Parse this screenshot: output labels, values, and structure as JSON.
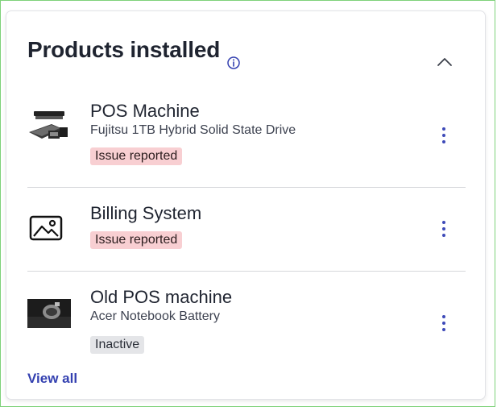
{
  "card": {
    "title": "Products installed",
    "view_all": "View all"
  },
  "products": [
    {
      "name": "POS Machine",
      "subtitle": "Fujitsu 1TB Hybrid Solid State Drive",
      "status": "Issue reported"
    },
    {
      "name": "Billing System",
      "subtitle": "",
      "status": "Issue reported"
    },
    {
      "name": "Old POS machine",
      "subtitle": "Acer Notebook Battery",
      "status": "Inactive"
    }
  ],
  "icons": {
    "info": "info-icon",
    "collapse": "chevron-up-icon",
    "more": "more-vertical-icon",
    "placeholder": "image-placeholder-icon"
  },
  "colors": {
    "accent": "#3340b0",
    "issue_badge_bg": "#f8cfd2",
    "inactive_badge_bg": "#e4e5e8",
    "frame_border": "#7ed27a"
  }
}
